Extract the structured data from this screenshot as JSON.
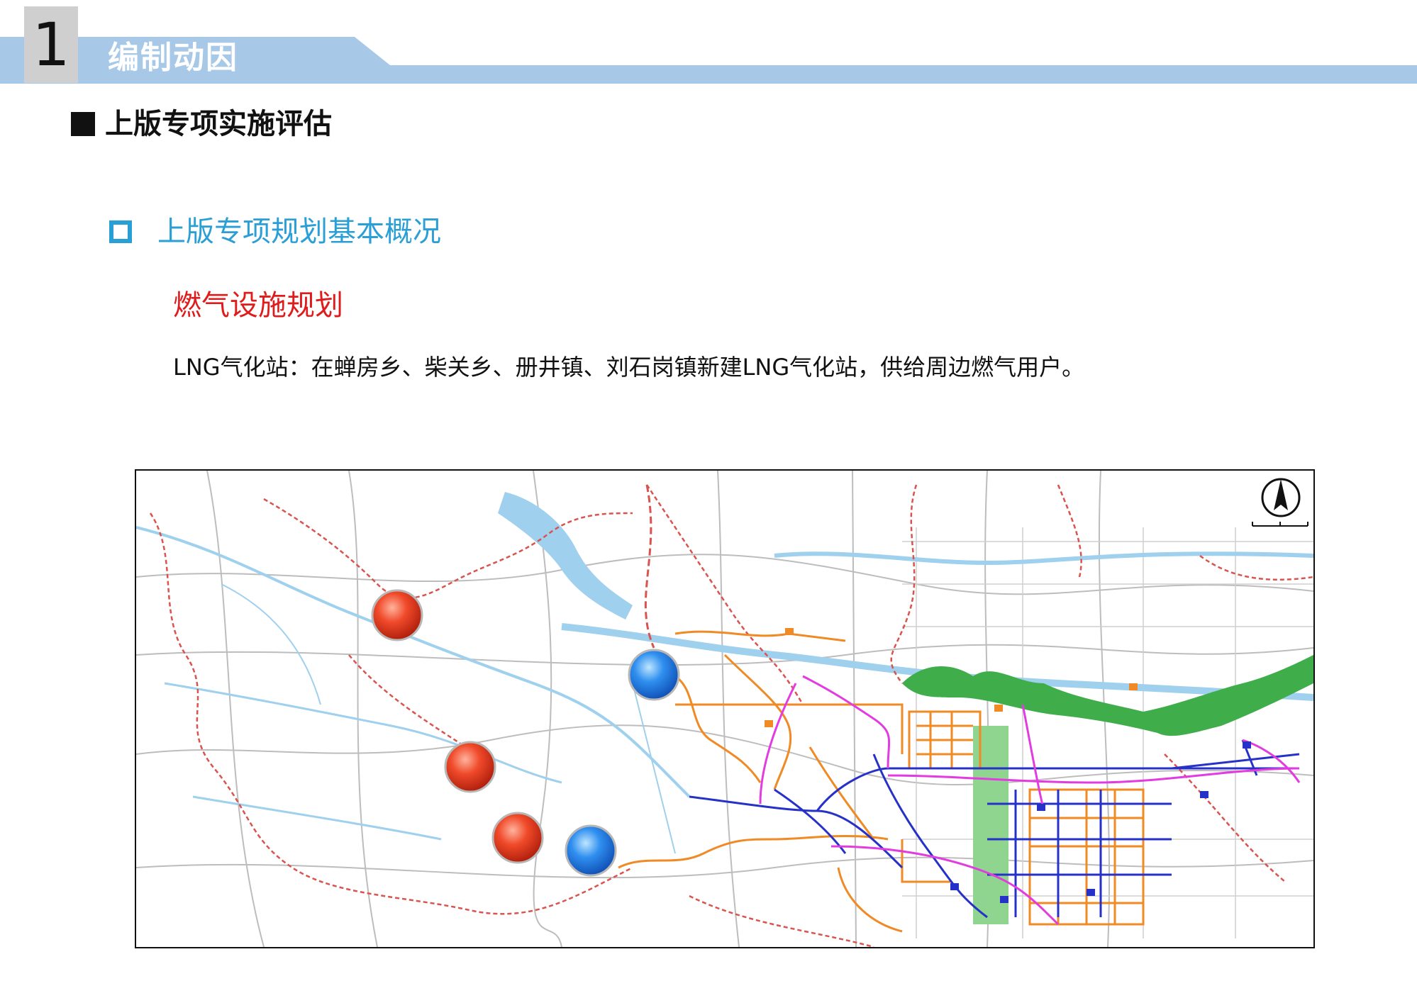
{
  "section": {
    "number": "1",
    "title": "编制动因"
  },
  "heading1": "上版专项实施评估",
  "heading2": "上版专项规划基本概况",
  "heading3": "燃气设施规划",
  "body": "LNG气化站：在蝉房乡、柴关乡、册井镇、刘石岗镇新建LNG气化站，供给周边燃气用户。",
  "colors": {
    "header_band": "#a7c8e6",
    "number_box": "#cfcfcf",
    "heading2": "#2a9fd6",
    "heading3": "#e01b1b",
    "marker_red": "#e0371b",
    "marker_blue": "#2f86e6",
    "water": "#9fd0ee",
    "green_zone": "#3fae4a",
    "gas_pipe_orange": "#f08a24",
    "gas_pipe_blue": "#2631c8",
    "gas_pipe_magenta": "#e23ce0",
    "boundary": "#d9534f"
  },
  "map": {
    "compass_icon": "north-arrow-icon",
    "markers": [
      {
        "name": "red-station-1",
        "color": "red"
      },
      {
        "name": "red-station-2",
        "color": "red"
      },
      {
        "name": "red-station-3",
        "color": "red"
      },
      {
        "name": "blue-station-1",
        "color": "blue"
      },
      {
        "name": "blue-station-2",
        "color": "blue"
      }
    ]
  }
}
